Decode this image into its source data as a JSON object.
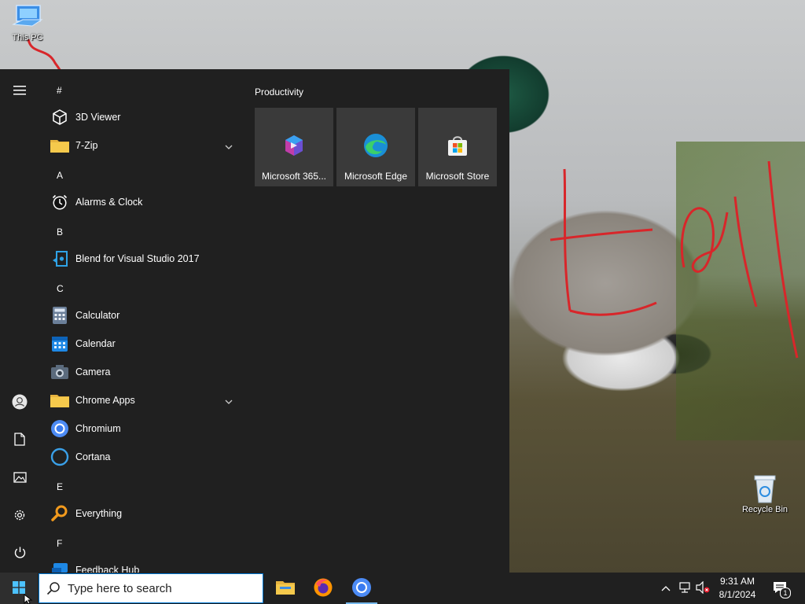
{
  "desktop": {
    "icons": [
      {
        "label": "This PC"
      },
      {
        "label": "Recycle Bin"
      }
    ]
  },
  "start_menu": {
    "rail": {
      "menu": "hamburger-icon",
      "user": "user-icon",
      "documents": "document-icon",
      "pictures": "pictures-icon",
      "settings": "gear-icon",
      "power": "power-icon"
    },
    "apps": [
      {
        "type": "letter",
        "text": "#"
      },
      {
        "type": "app",
        "label": "3D Viewer",
        "icon": "3d-viewer-icon"
      },
      {
        "type": "app",
        "label": "7-Zip",
        "icon": "folder-icon",
        "expandable": true
      },
      {
        "type": "letter",
        "text": "A"
      },
      {
        "type": "app",
        "label": "Alarms & Clock",
        "icon": "alarm-clock-icon"
      },
      {
        "type": "letter",
        "text": "B"
      },
      {
        "type": "app",
        "label": "Blend for Visual Studio 2017",
        "icon": "blend-icon"
      },
      {
        "type": "letter",
        "text": "C"
      },
      {
        "type": "app",
        "label": "Calculator",
        "icon": "calculator-icon"
      },
      {
        "type": "app",
        "label": "Calendar",
        "icon": "calendar-icon"
      },
      {
        "type": "app",
        "label": "Camera",
        "icon": "camera-icon"
      },
      {
        "type": "app",
        "label": "Chrome Apps",
        "icon": "folder-icon",
        "expandable": true
      },
      {
        "type": "app",
        "label": "Chromium",
        "icon": "chromium-icon"
      },
      {
        "type": "app",
        "label": "Cortana",
        "icon": "cortana-icon"
      },
      {
        "type": "letter",
        "text": "E"
      },
      {
        "type": "app",
        "label": "Everything",
        "icon": "search-magnifier-icon"
      },
      {
        "type": "letter",
        "text": "F"
      },
      {
        "type": "app",
        "label": "Feedback Hub",
        "icon": "feedback-icon"
      }
    ],
    "tiles_group": {
      "title": "Productivity",
      "tiles": [
        {
          "label": "Microsoft 365...",
          "icon": "microsoft-365-icon"
        },
        {
          "label": "Microsoft Edge",
          "icon": "edge-icon"
        },
        {
          "label": "Microsoft Store",
          "icon": "store-icon"
        }
      ]
    }
  },
  "taskbar": {
    "search_placeholder": "Type here to search",
    "pinned": [
      {
        "name": "file-explorer",
        "icon": "folder-icon"
      },
      {
        "name": "firefox",
        "icon": "firefox-icon"
      },
      {
        "name": "chromium",
        "icon": "chromium-icon"
      }
    ],
    "tray": {
      "time": "9:31 AM",
      "date": "8/1/2024",
      "notification_count": "1"
    }
  },
  "colors": {
    "start_bg": "#202020",
    "tile_bg": "#3a3a3a",
    "taskbar_bg": "#202020",
    "accent": "#0078d4"
  }
}
